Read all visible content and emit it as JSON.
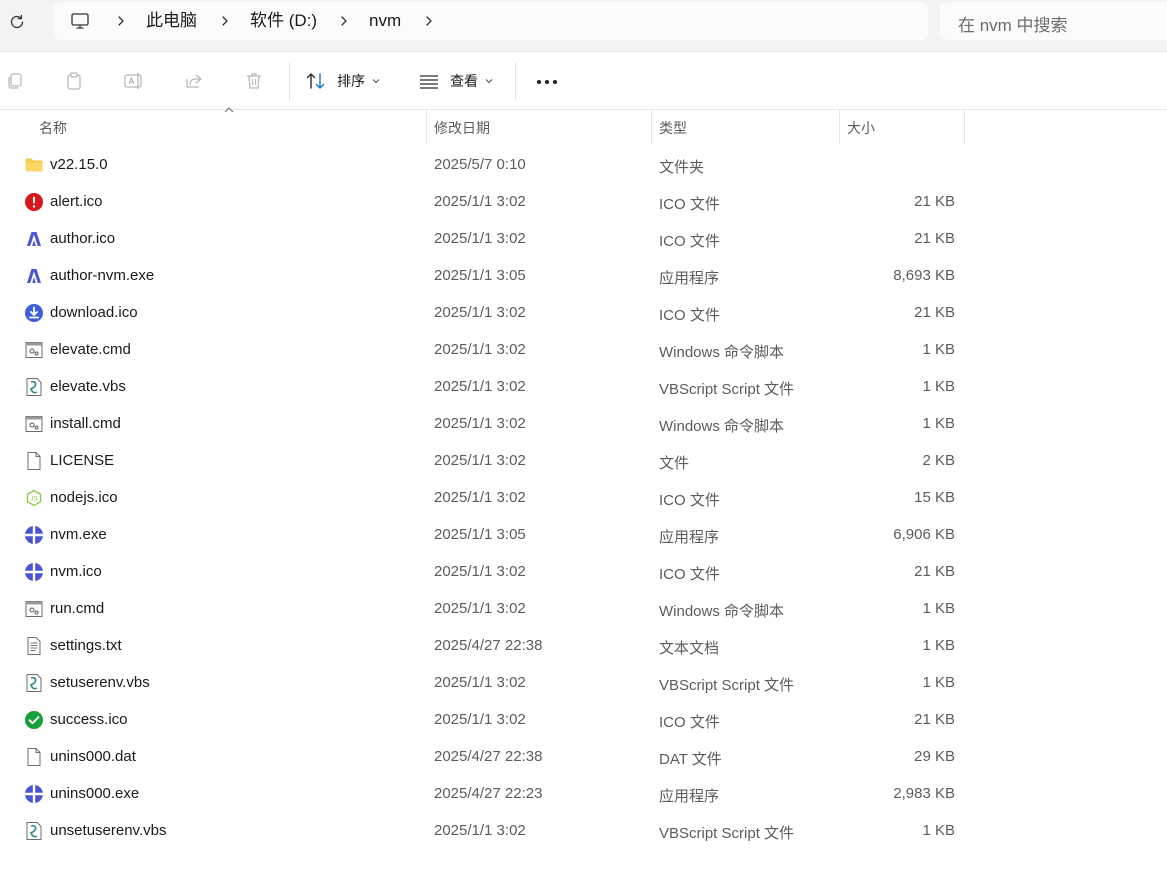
{
  "address": {
    "crumbs": [
      "此电脑",
      "软件 (D:)",
      "nvm"
    ],
    "search_placeholder": "在 nvm 中搜索"
  },
  "toolbar": {
    "copy": "copy-icon",
    "paste": "paste-icon",
    "rename": "rename-icon",
    "share": "share-icon",
    "delete": "delete-icon",
    "sort_label": "排序",
    "view_label": "查看",
    "more_label": "•••"
  },
  "columns": {
    "name": "名称",
    "modified": "修改日期",
    "type": "类型",
    "size": "大小"
  },
  "files": [
    {
      "icon": "folder-icon",
      "name": "v22.15.0",
      "modified": "2025/5/7 0:10",
      "type": "文件夹",
      "size": ""
    },
    {
      "icon": "alert-icon",
      "name": "alert.ico",
      "modified": "2025/1/1 3:02",
      "type": "ICO 文件",
      "size": "21 KB"
    },
    {
      "icon": "author-icon",
      "name": "author.ico",
      "modified": "2025/1/1 3:02",
      "type": "ICO 文件",
      "size": "21 KB"
    },
    {
      "icon": "author-icon",
      "name": "author-nvm.exe",
      "modified": "2025/1/1 3:05",
      "type": "应用程序",
      "size": "8,693 KB"
    },
    {
      "icon": "download-icon",
      "name": "download.ico",
      "modified": "2025/1/1 3:02",
      "type": "ICO 文件",
      "size": "21 KB"
    },
    {
      "icon": "cmd-icon",
      "name": "elevate.cmd",
      "modified": "2025/1/1 3:02",
      "type": "Windows 命令脚本",
      "size": "1 KB"
    },
    {
      "icon": "vbs-icon",
      "name": "elevate.vbs",
      "modified": "2025/1/1 3:02",
      "type": "VBScript Script 文件",
      "size": "1 KB"
    },
    {
      "icon": "cmd-icon",
      "name": "install.cmd",
      "modified": "2025/1/1 3:02",
      "type": "Windows 命令脚本",
      "size": "1 KB"
    },
    {
      "icon": "file-icon",
      "name": "LICENSE",
      "modified": "2025/1/1 3:02",
      "type": "文件",
      "size": "2 KB"
    },
    {
      "icon": "nodejs-icon",
      "name": "nodejs.ico",
      "modified": "2025/1/1 3:02",
      "type": "ICO 文件",
      "size": "15 KB"
    },
    {
      "icon": "nvm-icon",
      "name": "nvm.exe",
      "modified": "2025/1/1 3:05",
      "type": "应用程序",
      "size": "6,906 KB"
    },
    {
      "icon": "nvm-icon",
      "name": "nvm.ico",
      "modified": "2025/1/1 3:02",
      "type": "ICO 文件",
      "size": "21 KB"
    },
    {
      "icon": "cmd-icon",
      "name": "run.cmd",
      "modified": "2025/1/1 3:02",
      "type": "Windows 命令脚本",
      "size": "1 KB"
    },
    {
      "icon": "text-icon",
      "name": "settings.txt",
      "modified": "2025/4/27 22:38",
      "type": "文本文档",
      "size": "1 KB"
    },
    {
      "icon": "vbs-icon",
      "name": "setuserenv.vbs",
      "modified": "2025/1/1 3:02",
      "type": "VBScript Script 文件",
      "size": "1 KB"
    },
    {
      "icon": "success-icon",
      "name": "success.ico",
      "modified": "2025/1/1 3:02",
      "type": "ICO 文件",
      "size": "21 KB"
    },
    {
      "icon": "file-icon",
      "name": "unins000.dat",
      "modified": "2025/4/27 22:38",
      "type": "DAT 文件",
      "size": "29 KB"
    },
    {
      "icon": "nvm-icon",
      "name": "unins000.exe",
      "modified": "2025/4/27 22:23",
      "type": "应用程序",
      "size": "2,983 KB"
    },
    {
      "icon": "vbs-icon",
      "name": "unsetuserenv.vbs",
      "modified": "2025/1/1 3:02",
      "type": "VBScript Script 文件",
      "size": "1 KB"
    }
  ]
}
